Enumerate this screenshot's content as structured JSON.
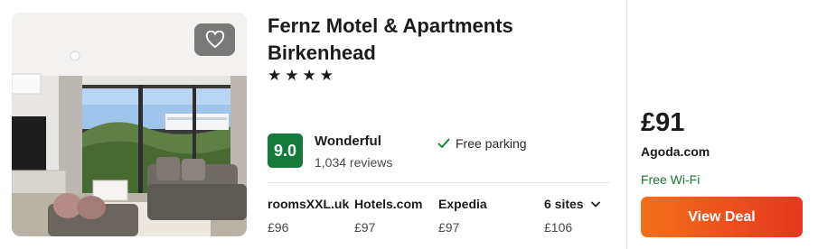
{
  "hotel": {
    "name_line1": "Fernz Motel & Apartments",
    "name_line2": "Birkenhead",
    "stars_text": "★★★★",
    "star_rating": 4,
    "rating_score": "9.0",
    "rating_word": "Wonderful",
    "review_count": "1,034 reviews",
    "amenity": "Free parking"
  },
  "sites": [
    {
      "name": "roomsXXL.uk",
      "price": "£96"
    },
    {
      "name": "Hotels.com",
      "price": "£97"
    },
    {
      "name": "Expedia",
      "price": "£97"
    },
    {
      "name": "6 sites",
      "price": "£106"
    }
  ],
  "deal": {
    "price": "£91",
    "site": "Agoda.com",
    "perk": "Free Wi-Fi",
    "button_label": "View Deal"
  },
  "colors": {
    "rating_green": "#137a3a",
    "button_orange": "#f2701a",
    "button_red": "#e5361f"
  },
  "icons": [
    "heart-icon",
    "check-icon",
    "chevron-down-icon"
  ]
}
